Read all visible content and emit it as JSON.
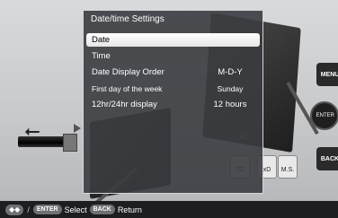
{
  "dialog": {
    "title": "Date/time Settings",
    "items": [
      {
        "label": "Date",
        "value": ""
      },
      {
        "label": "Time",
        "value": ""
      },
      {
        "label": "Date Display Order",
        "value": "M-D-Y"
      },
      {
        "label": "First day of the week",
        "value": "Sunday"
      },
      {
        "label": "12hr/24hr display",
        "value": "12 hours"
      }
    ],
    "selected_index": 0
  },
  "device": {
    "menu_label": "MENU",
    "enter_label": "ENTER",
    "back_label": "BACK",
    "slots": [
      "SD",
      "xD",
      "M.S."
    ]
  },
  "footer": {
    "enter_key": "ENTER",
    "select_label": "Select",
    "back_key": "BACK",
    "return_label": "Return"
  },
  "icons": [
    "usb-icon",
    "arrow-keys-icon"
  ]
}
